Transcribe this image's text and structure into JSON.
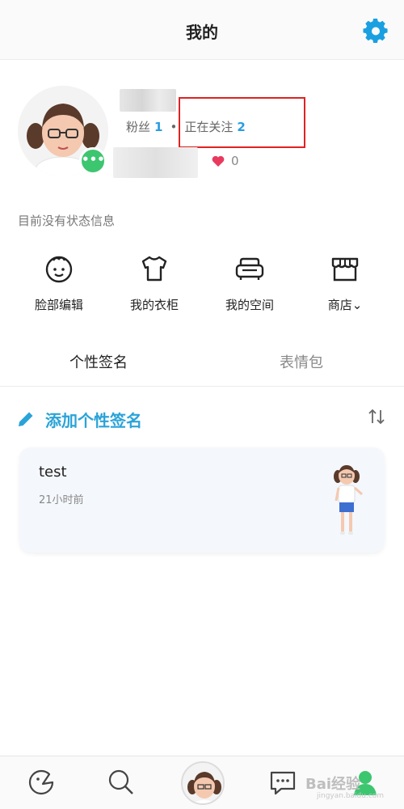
{
  "header": {
    "title": "我的"
  },
  "profile": {
    "fans_label": "粉丝",
    "fans_count": "1",
    "separator": "•",
    "following_label": "正在关注",
    "following_count": "2",
    "likes_count": "0",
    "status": "目前没有状态信息"
  },
  "actions": [
    {
      "label": "脸部编辑",
      "icon": "face-icon"
    },
    {
      "label": "我的衣柜",
      "icon": "shirt-icon"
    },
    {
      "label": "我的空间",
      "icon": "sofa-icon"
    },
    {
      "label": "商店⌄",
      "icon": "store-icon"
    }
  ],
  "tabs": [
    {
      "label": "个性签名",
      "active": true
    },
    {
      "label": "表情包",
      "active": false
    }
  ],
  "signature": {
    "add_label": "添加个性签名",
    "entries": [
      {
        "text": "test",
        "time": "21小时前"
      }
    ]
  },
  "watermark": {
    "text": "Bai经验",
    "sub": "jingyan.baidu.com"
  },
  "colors": {
    "accent": "#2aa3d8",
    "settings": "#1aa0e0",
    "badge": "#3cc66f",
    "highlight": "#e02222",
    "heart": "#e83a5f"
  }
}
